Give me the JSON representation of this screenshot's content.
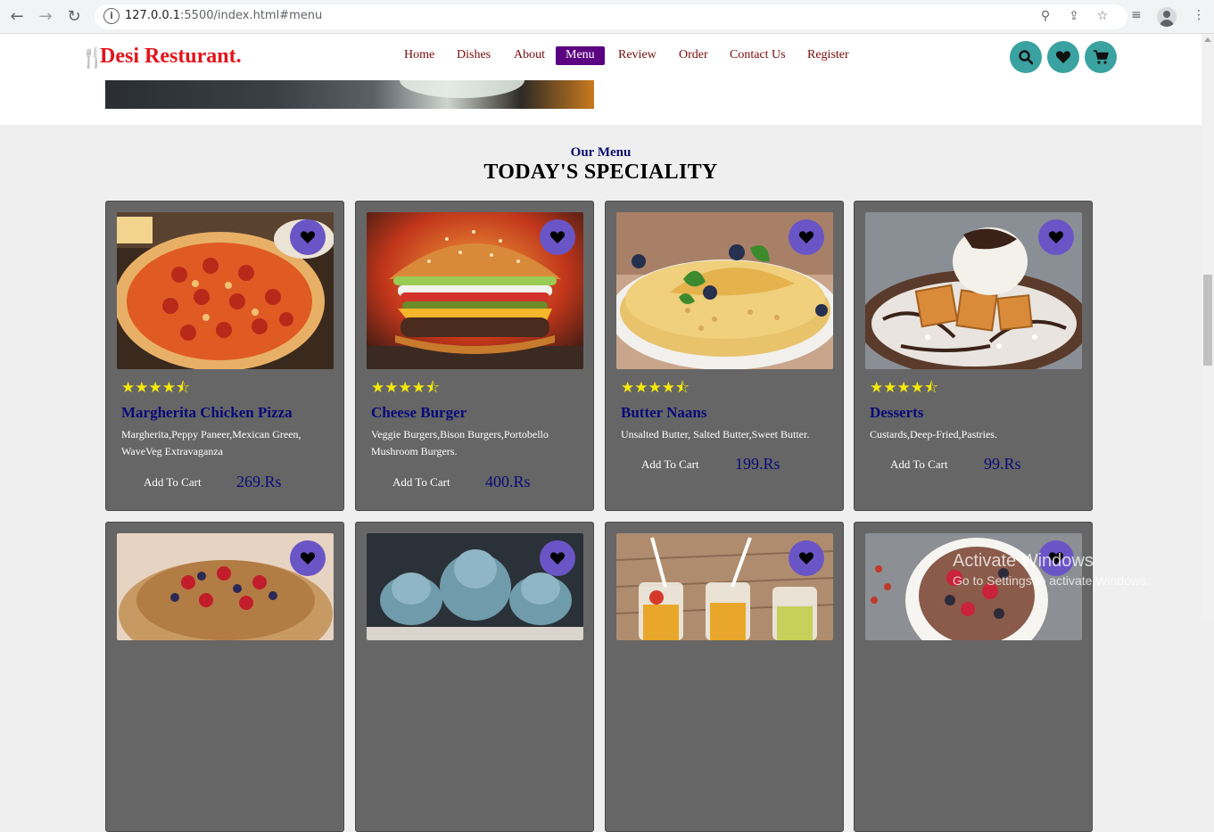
{
  "browser": {
    "url_host": "127.0.0.1",
    "url_rest": ":5500/index.html#menu"
  },
  "site": {
    "logo": "Desi Resturant.",
    "nav": [
      "Home",
      "Dishes",
      "About",
      "Menu",
      "Review",
      "Order",
      "Contact Us",
      "Register"
    ],
    "active_nav": "Menu"
  },
  "section": {
    "subtitle": "Our Menu",
    "title": "TODAY'S SPECIALITY"
  },
  "rating_stars": "★★★★",
  "cards": [
    {
      "name": "Margherita Chicken Pizza",
      "desc": "Margherita,Peppy Paneer,Mexican Green, WaveVeg Extravaganza",
      "add": "Add To Cart",
      "price": "269.Rs",
      "rating": 4.5
    },
    {
      "name": "Cheese Burger",
      "desc": "Veggie Burgers,Bison Burgers,Portobello Mushroom Burgers.",
      "add": "Add To Cart",
      "price": "400.Rs",
      "rating": 4.5
    },
    {
      "name": "Butter Naans",
      "desc": "Unsalted Butter, Salted Butter,Sweet Butter.",
      "add": "Add To Cart",
      "price": "199.Rs",
      "rating": 4.5
    },
    {
      "name": "Desserts",
      "desc": "Custards,Deep-Fried,Pastries.",
      "add": "Add To Cart",
      "price": "99.Rs",
      "rating": 4.5
    }
  ],
  "colors": {
    "logo_red": "#e4131b",
    "nav_active_bg": "#5b0081",
    "icon_button": "#3aa2a0",
    "heart_button": "#6a55c6",
    "card_bg": "#666666",
    "star": "#f4e80a",
    "dish_name": "#08087a"
  },
  "watermark": {
    "line1": "Activate Windows",
    "line2": "Go to Settings to activate Windows."
  }
}
